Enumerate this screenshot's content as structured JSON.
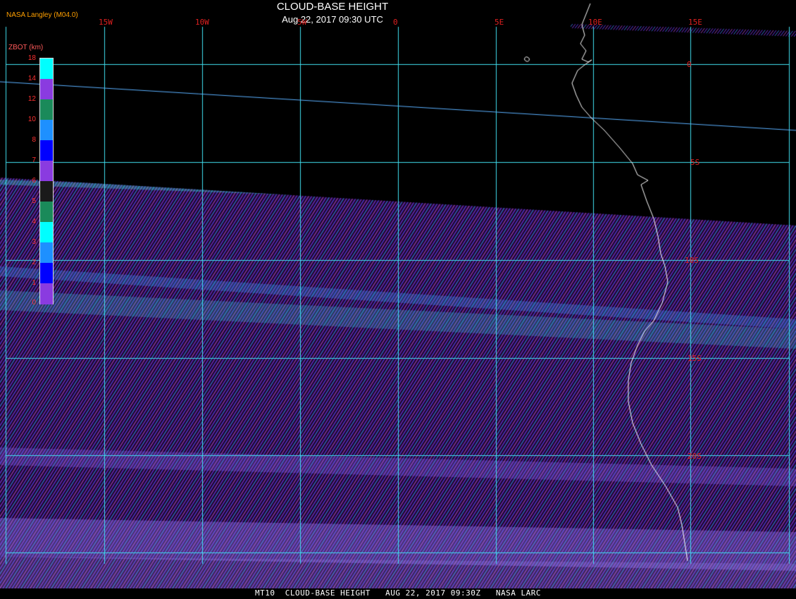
{
  "header": {
    "title": "CLOUD-BASE HEIGHT",
    "date": "Aug 22, 2017 09:30 UTC",
    "provider": "NASA Langley (M04.0)"
  },
  "legend": {
    "label": "ZBOT (km)",
    "ticks": [
      "18",
      "14",
      "12",
      "10",
      "8",
      "7",
      "6",
      "5",
      "4",
      "3",
      "2",
      "1",
      "0"
    ],
    "colors": [
      "#00ffff",
      "#8a3be0",
      "#1a8a5a",
      "#1e90ff",
      "#0000ff",
      "#8a3be0",
      "#1a1a1a",
      "#1a8a5a",
      "#00ffff",
      "#1e90ff",
      "#0000ff",
      "#8a3be0"
    ]
  },
  "grid": {
    "longitudes": [
      "15W",
      "10W",
      "5W",
      "0",
      "5E",
      "10E",
      "15E"
    ],
    "latitudes": [
      "0",
      "5S",
      "10S",
      "15S",
      "20S"
    ],
    "line_color": "#40e0f0"
  },
  "footer": {
    "text": "MT10  CLOUD-BASE HEIGHT   AUG 22, 2017 09:30Z   NASA LARC"
  }
}
